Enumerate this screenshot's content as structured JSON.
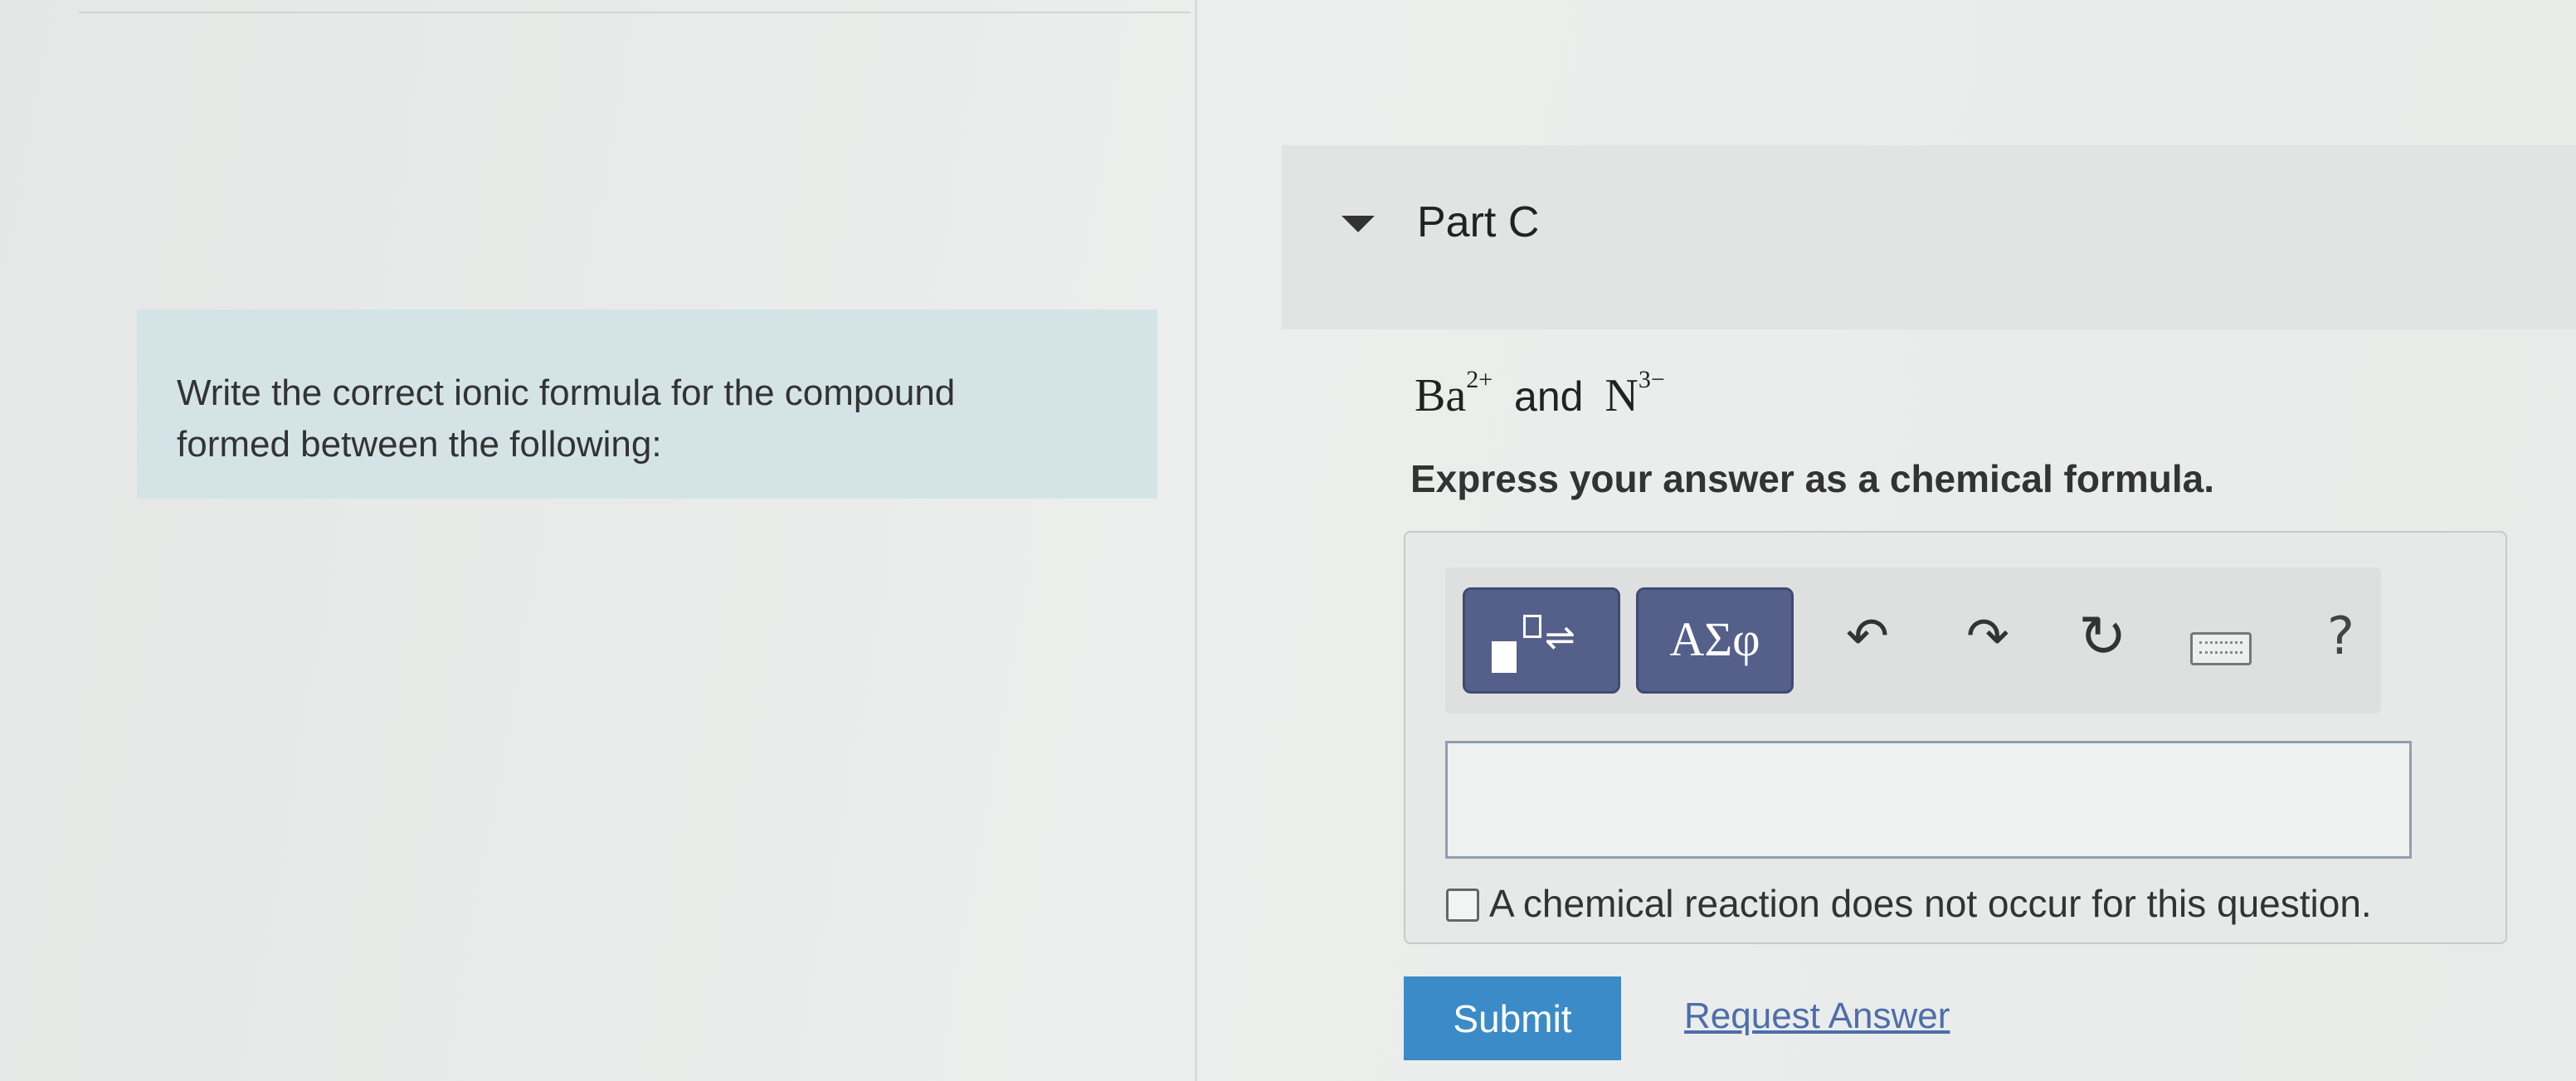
{
  "instruction": {
    "line1": "Write the correct ionic formula for the compound",
    "line2": "formed between the following:"
  },
  "part": {
    "title": "Part C"
  },
  "question": {
    "cation": "Ba",
    "cation_charge": "2+",
    "conjunction": "and",
    "anion": "N",
    "anion_charge": "3−",
    "prompt": "Express your answer as a chemical formula."
  },
  "toolbar": {
    "template_arrows": "⇌",
    "greek_label": "ΑΣφ",
    "undo_glyph": "↶",
    "redo_glyph": "↷",
    "reset_glyph": "↻",
    "help_glyph": "?",
    "icons": [
      "templates-icon",
      "greek-symbols-icon",
      "undo-icon",
      "redo-icon",
      "reset-icon",
      "keyboard-icon",
      "help-icon"
    ]
  },
  "answer": {
    "value": "",
    "no_reaction_label": "A chemical reaction does not occur for this question.",
    "no_reaction_checked": false
  },
  "actions": {
    "submit_label": "Submit",
    "request_answer_label": "Request Answer"
  },
  "colors": {
    "instruction_bg": "#d4e4e6",
    "toolbar_button": "#55608a",
    "submit_bg": "#3b8bc8",
    "link": "#4d6ea8"
  }
}
